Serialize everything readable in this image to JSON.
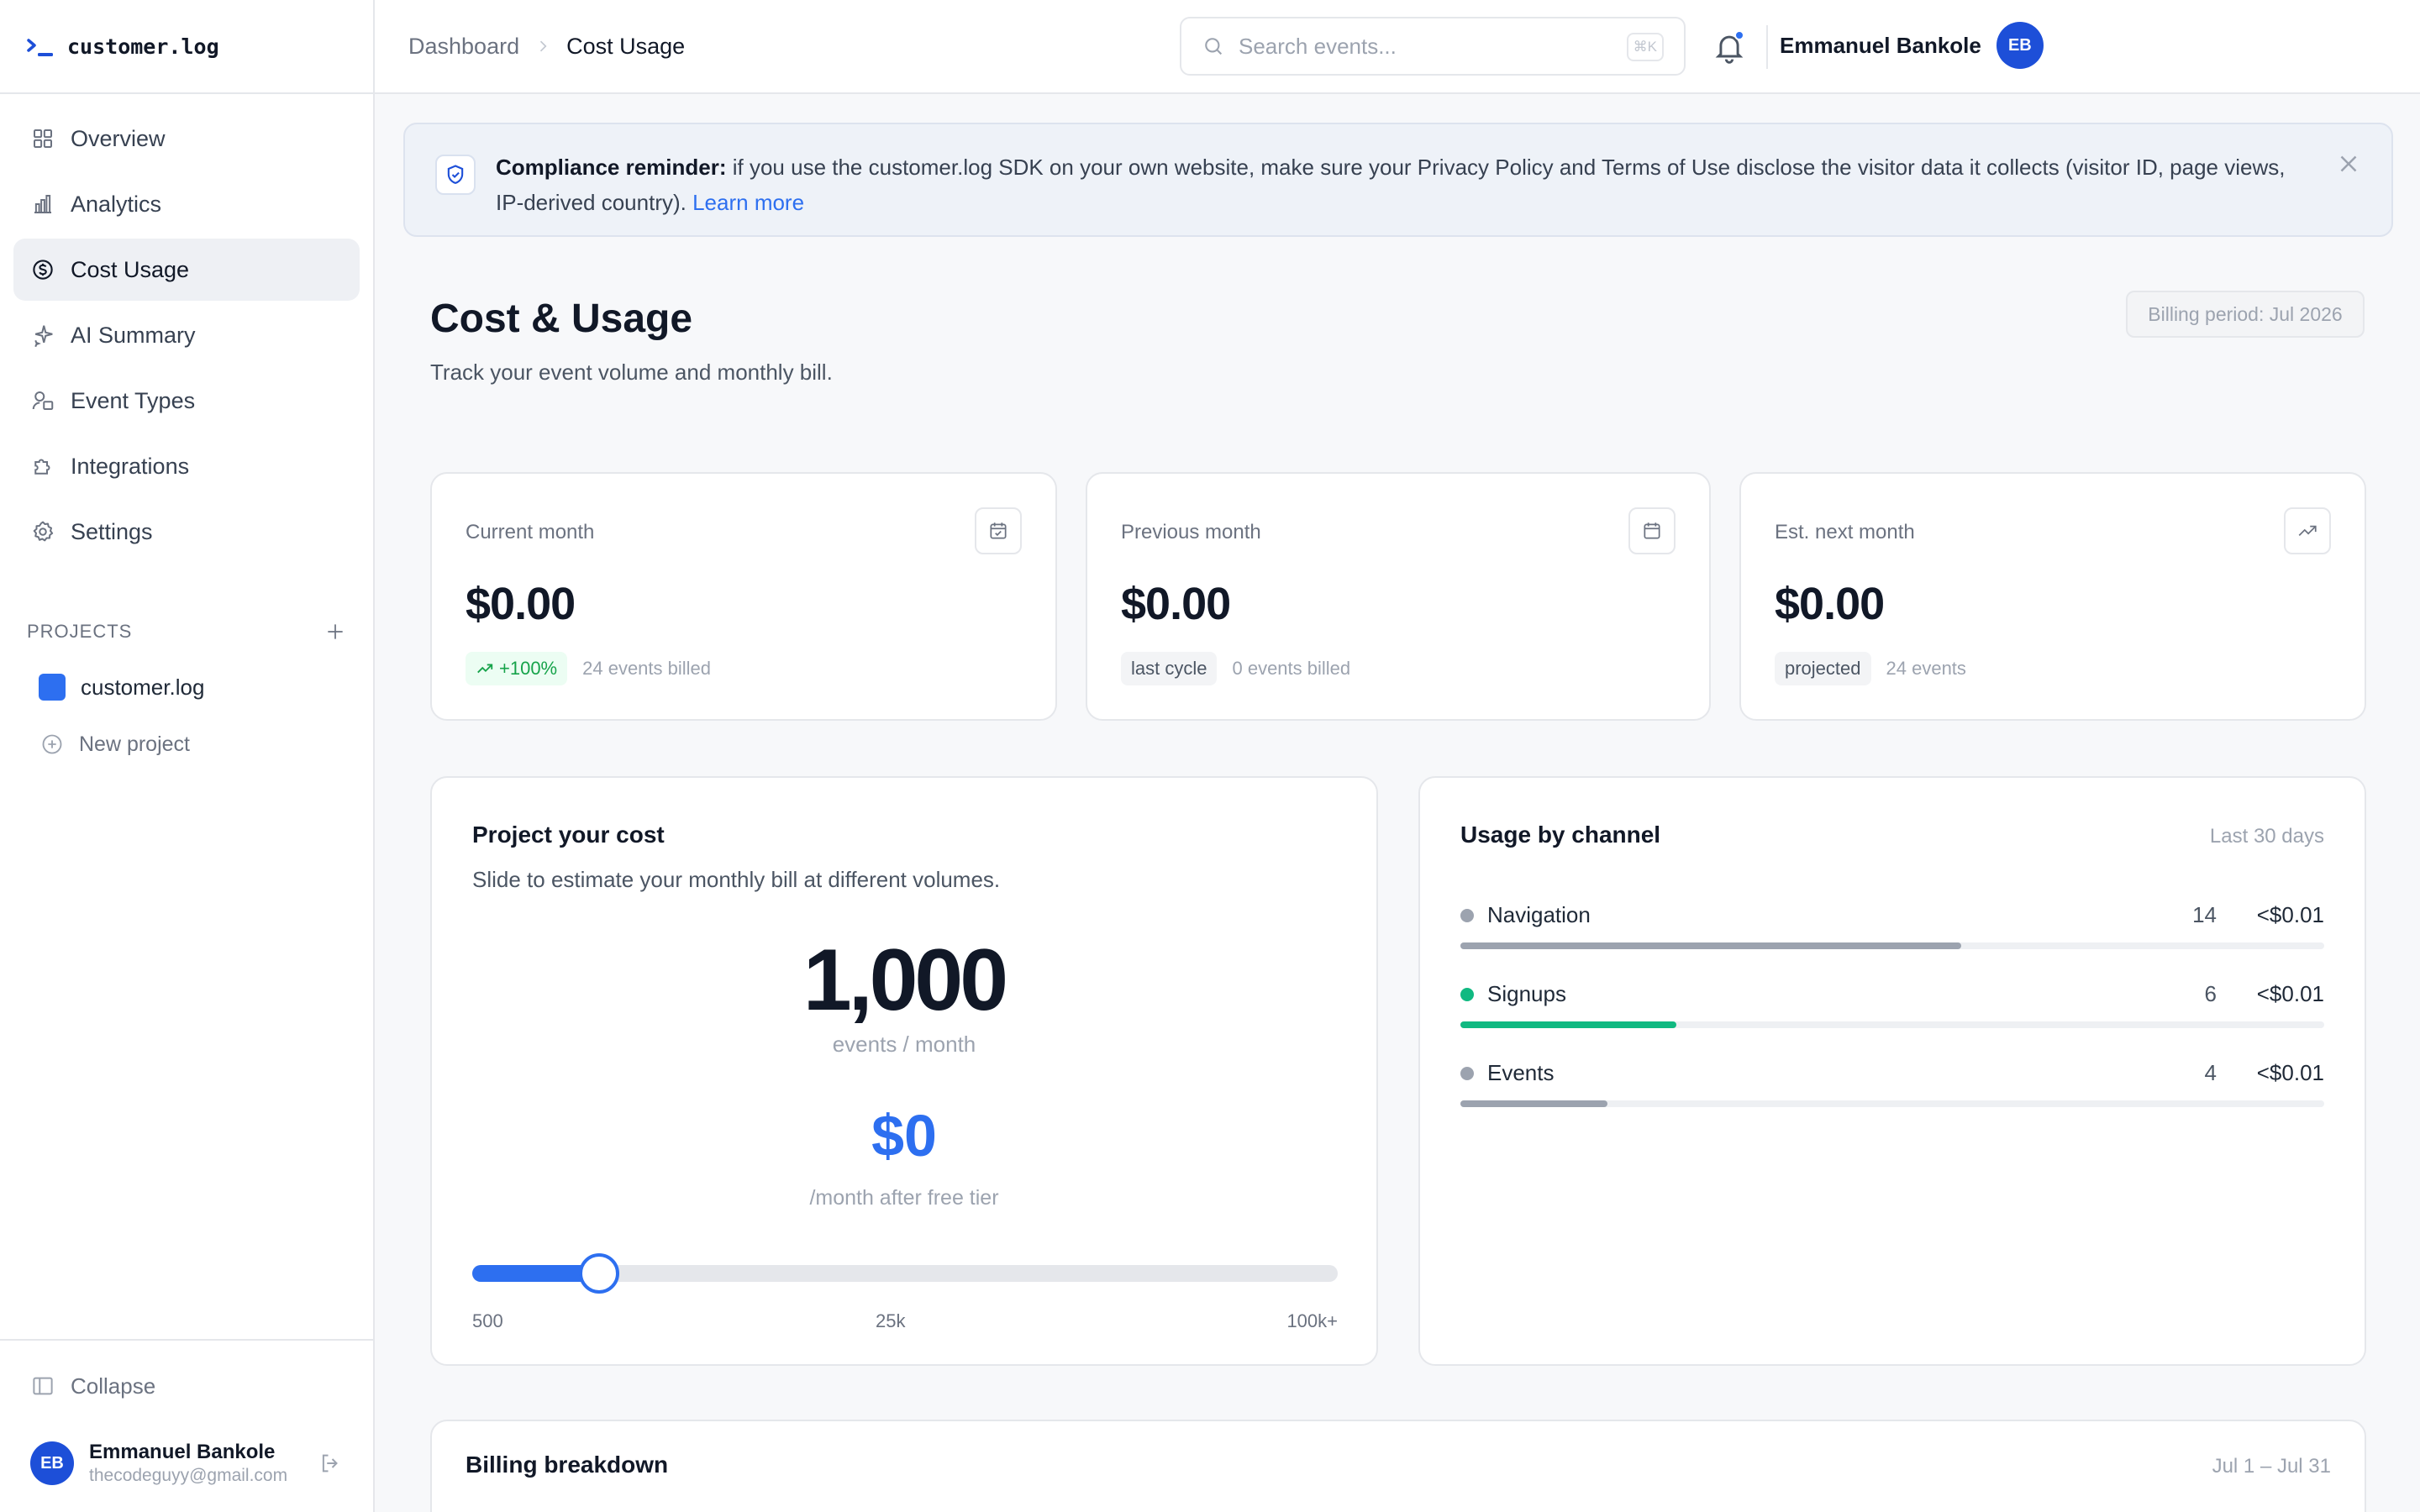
{
  "app": {
    "logo_text": "customer.log"
  },
  "sidebar": {
    "items": [
      {
        "label": "Overview",
        "icon": "grid-icon"
      },
      {
        "label": "Analytics",
        "icon": "bar-chart-icon"
      },
      {
        "label": "Cost Usage",
        "icon": "dollar-circle-icon",
        "active": true
      },
      {
        "label": "AI Summary",
        "icon": "sparkle-icon"
      },
      {
        "label": "Event Types",
        "icon": "shapes-icon"
      },
      {
        "label": "Integrations",
        "icon": "puzzle-icon"
      },
      {
        "label": "Settings",
        "icon": "gear-icon"
      }
    ],
    "projects_heading": "PROJECTS",
    "projects": [
      {
        "name": "customer.log",
        "color": "#2d6ff0"
      }
    ],
    "new_project_label": "New project",
    "collapse_label": "Collapse",
    "user": {
      "initials": "EB",
      "name": "Emmanuel Bankole",
      "email": "thecodeguyy@gmail.com"
    }
  },
  "header": {
    "breadcrumb": [
      "Dashboard",
      "Cost Usage"
    ],
    "search_placeholder": "Search events...",
    "search_shortcut": "⌘K",
    "user_name": "Emmanuel Bankole",
    "user_initials": "EB"
  },
  "banner": {
    "bold": "Compliance reminder:",
    "text": " if you use the customer.log SDK on your own website, make sure your Privacy Policy and Terms of Use disclose the visitor data it collects (visitor ID, page views, IP-derived country). ",
    "link": "Learn more"
  },
  "page": {
    "title": "Cost & Usage",
    "subtitle": "Track your event volume and monthly bill.",
    "billing_period": "Billing period: Jul 2026"
  },
  "stats": [
    {
      "label": "Current month",
      "value": "$0.00",
      "tag": "+100%",
      "tag_style": "green",
      "foot": "24 events billed",
      "icon": "calendar-check-icon"
    },
    {
      "label": "Previous month",
      "value": "$0.00",
      "tag": "last cycle",
      "tag_style": "gray",
      "foot": "0 events billed",
      "icon": "calendar-icon"
    },
    {
      "label": "Est. next month",
      "value": "$0.00",
      "tag": "projected",
      "tag_style": "gray",
      "foot": "24 events",
      "icon": "trend-up-icon"
    }
  ],
  "projector": {
    "title": "Project your cost",
    "subtitle": "Slide to estimate your monthly bill at different volumes.",
    "events": "1,000",
    "events_unit": "events / month",
    "price": "$0",
    "price_unit": "/month after free tier",
    "slider_fraction": 0.147,
    "slider_labels": [
      "500",
      "25k",
      "100k+"
    ],
    "accent": "#2d6ff0"
  },
  "channels": {
    "title": "Usage by channel",
    "period": "Last 30 days",
    "rows": [
      {
        "name": "Navigation",
        "count": "14",
        "cost": "<$0.01",
        "share": 0.58,
        "color": "#9ca3af"
      },
      {
        "name": "Signups",
        "count": "6",
        "cost": "<$0.01",
        "share": 0.25,
        "color": "#10b981"
      },
      {
        "name": "Events",
        "count": "4",
        "cost": "<$0.01",
        "share": 0.17,
        "color": "#9ca3af"
      }
    ]
  },
  "billing": {
    "title": "Billing breakdown",
    "range": "Jul 1 – Jul 31"
  }
}
